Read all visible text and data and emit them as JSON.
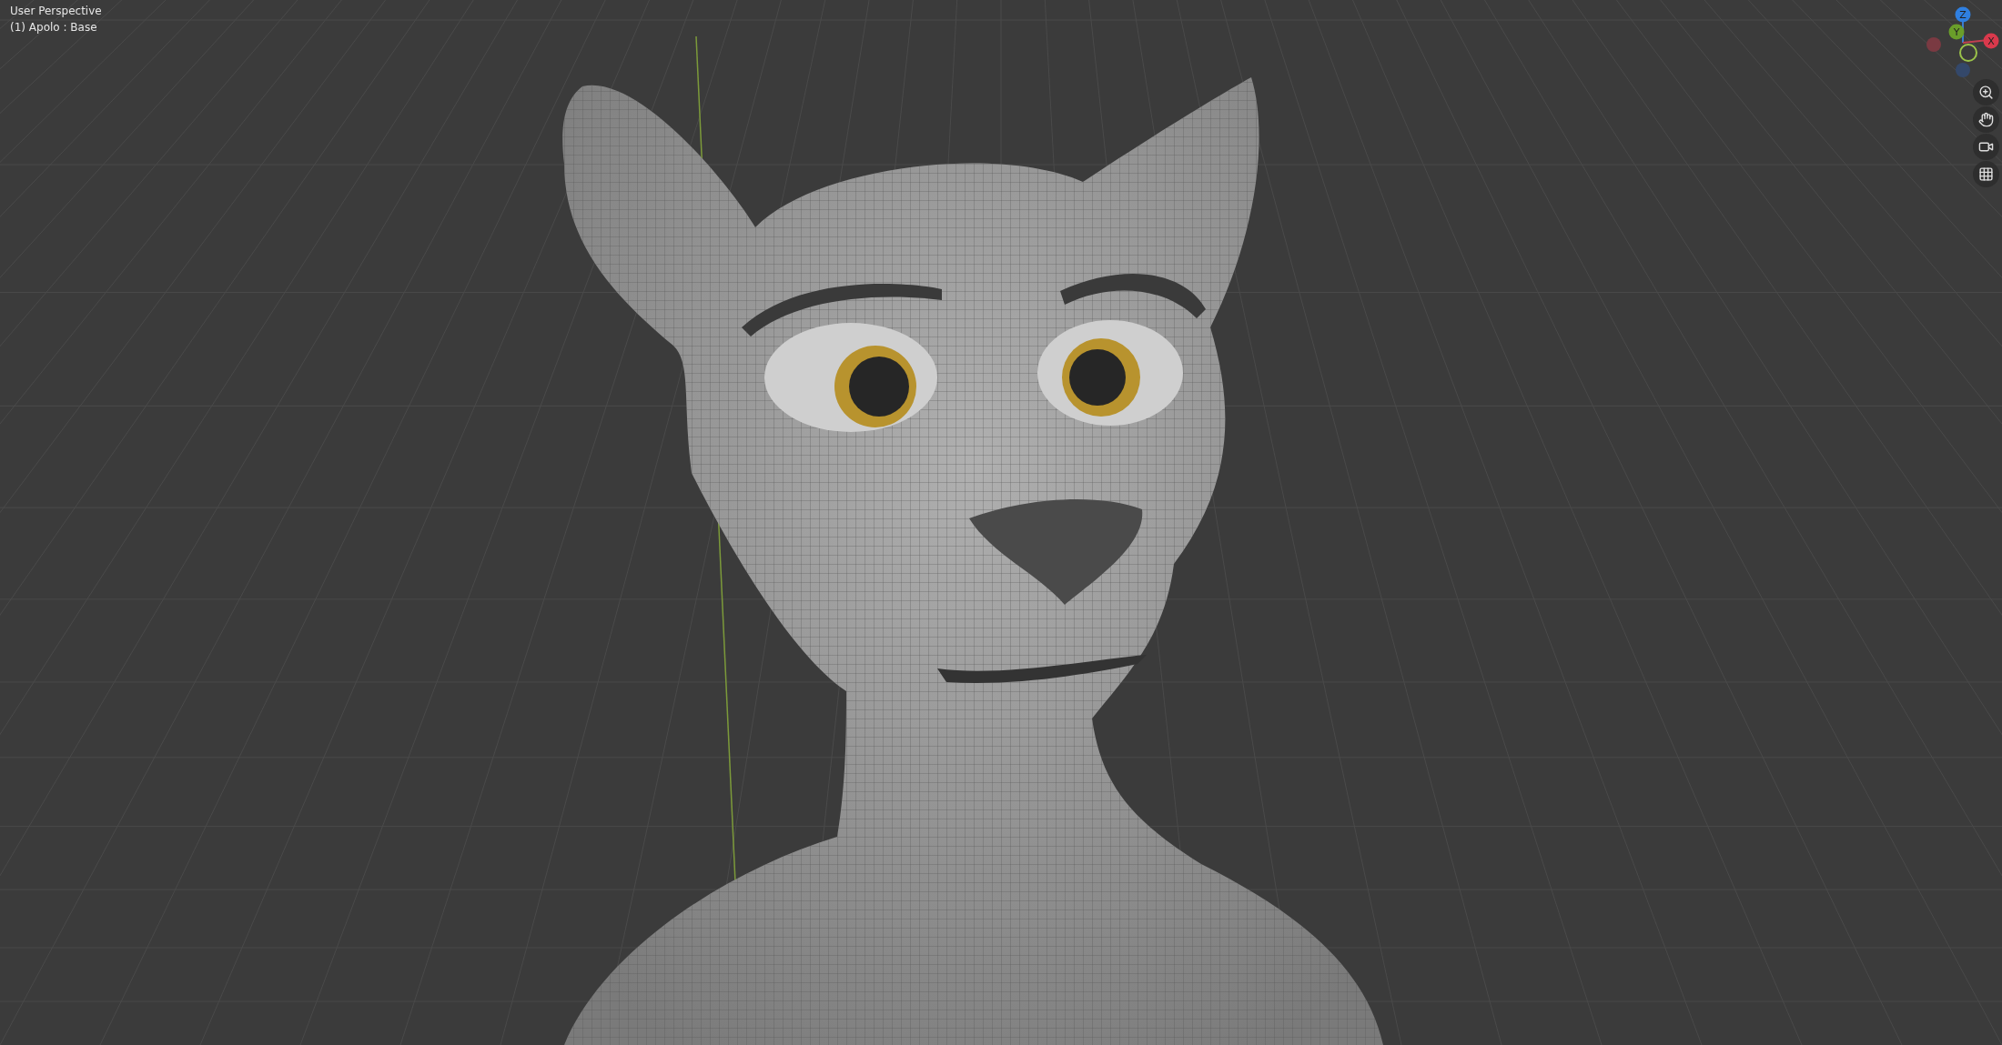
{
  "viewport": {
    "view_name": "User Perspective",
    "object_label": "(1) Apolo : Base"
  },
  "gizmo": {
    "axes": [
      {
        "label": "Z",
        "color": "#2f7fe0"
      },
      {
        "label": "Y",
        "color": "#6a9e2a"
      },
      {
        "label": "X",
        "color": "#d9394c"
      }
    ]
  },
  "nav_buttons": [
    {
      "kind": "zoom"
    },
    {
      "kind": "pan"
    },
    {
      "kind": "camera"
    },
    {
      "kind": "ortho"
    }
  ]
}
